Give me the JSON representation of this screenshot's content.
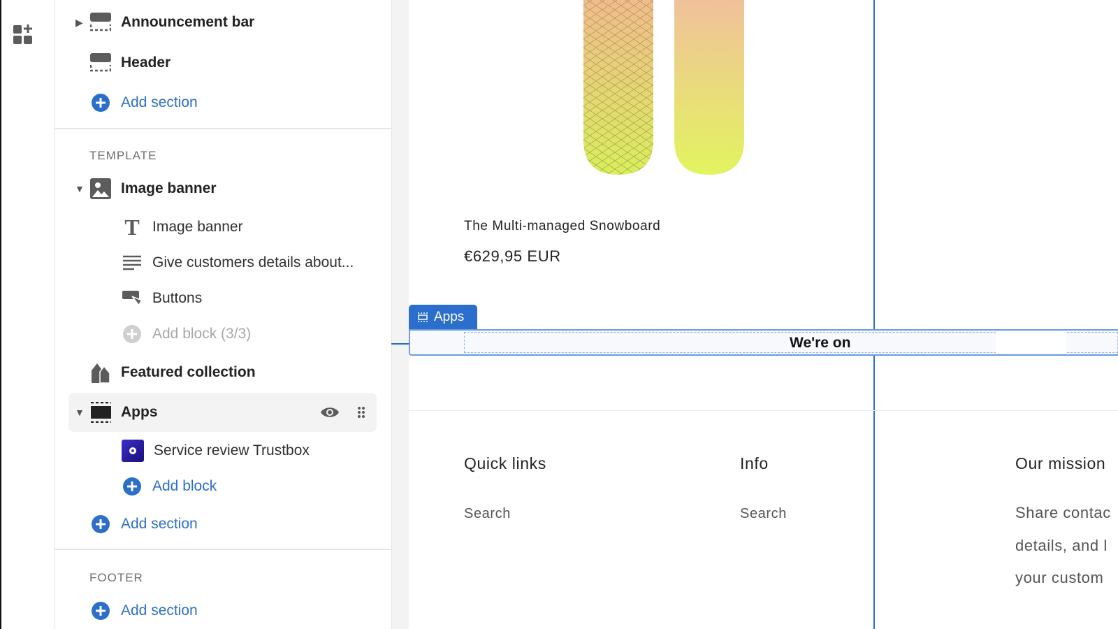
{
  "rail": {
    "icon": "add-apps-icon"
  },
  "sidebar": {
    "header_items": [
      {
        "label": "Announcement bar",
        "icon": "section-icon",
        "collapsed": true
      },
      {
        "label": "Header",
        "icon": "section-icon"
      }
    ],
    "header_add_section": "Add section",
    "template_caption": "TEMPLATE",
    "image_banner": {
      "label": "Image banner",
      "blocks": [
        {
          "label": "Image banner",
          "icon": "text-icon"
        },
        {
          "label": "Give customers details about...",
          "icon": "paragraph-icon"
        },
        {
          "label": "Buttons",
          "icon": "button-icon"
        }
      ],
      "add_block": "Add block (3/3)"
    },
    "featured_collection": "Featured collection",
    "apps": {
      "label": "Apps",
      "blocks": [
        {
          "label": "Service review Trustbox",
          "icon": "trustpilot-app-icon"
        }
      ],
      "add_block": "Add block"
    },
    "template_add_section": "Add section",
    "footer_caption": "FOOTER",
    "footer_add_section": "Add section"
  },
  "preview": {
    "product_title": "The Multi-managed Snowboard",
    "product_price": "€629,95 EUR",
    "apps_tab": "Apps",
    "banner_text": "We're on",
    "footer": {
      "columns": [
        {
          "heading": "Quick links",
          "links": [
            "Search"
          ]
        },
        {
          "heading": "Info",
          "links": [
            "Search"
          ]
        },
        {
          "heading": "Our mission",
          "lines": [
            "Share contac",
            "details, and l",
            "your custom"
          ]
        }
      ]
    }
  },
  "colors": {
    "accent": "#2c6ecb",
    "selected_row": "#f3f3f3"
  }
}
